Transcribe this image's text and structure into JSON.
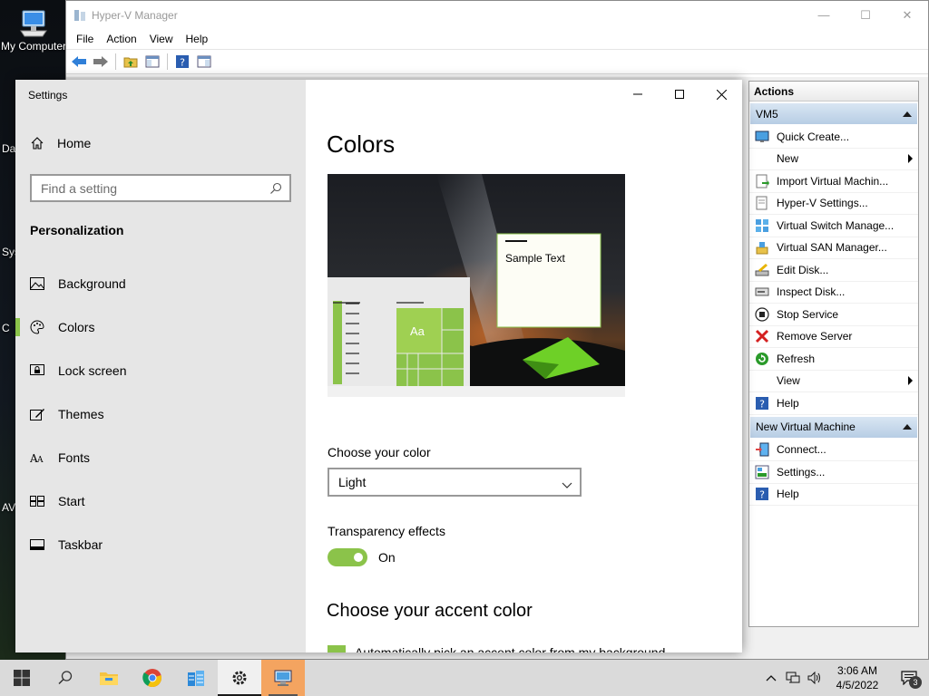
{
  "desktop": {
    "icon_label": "My Computer",
    "partial_labels": [
      "Da",
      "Sys",
      "C",
      "AV"
    ]
  },
  "hyperv": {
    "title": "Hyper-V Manager",
    "menu": [
      "File",
      "Action",
      "View",
      "Help"
    ],
    "actions_title": "Actions",
    "group1": {
      "name": "VM5",
      "items": [
        {
          "label": "Quick Create...",
          "icon": "quick-create-icon"
        },
        {
          "label": "New",
          "icon": "none",
          "submenu": true
        },
        {
          "label": "Import Virtual Machin...",
          "icon": "import-vm-icon"
        },
        {
          "label": "Hyper-V Settings...",
          "icon": "hyperv-settings-icon"
        },
        {
          "label": "Virtual Switch Manage...",
          "icon": "virtual-switch-icon"
        },
        {
          "label": "Virtual SAN Manager...",
          "icon": "virtual-san-icon"
        },
        {
          "label": "Edit Disk...",
          "icon": "edit-disk-icon"
        },
        {
          "label": "Inspect Disk...",
          "icon": "inspect-disk-icon"
        },
        {
          "label": "Stop Service",
          "icon": "stop-service-icon"
        },
        {
          "label": "Remove Server",
          "icon": "remove-server-icon"
        },
        {
          "label": "Refresh",
          "icon": "refresh-icon"
        },
        {
          "label": "View",
          "icon": "none",
          "submenu": true
        },
        {
          "label": "Help",
          "icon": "help-icon"
        }
      ]
    },
    "group2": {
      "name": "New Virtual Machine",
      "items": [
        {
          "label": "Connect...",
          "icon": "connect-icon"
        },
        {
          "label": "Settings...",
          "icon": "vm-settings-icon"
        },
        {
          "label": "Help",
          "icon": "help-icon"
        }
      ]
    }
  },
  "settings": {
    "app_title": "Settings",
    "home": "Home",
    "search_placeholder": "Find a setting",
    "section": "Personalization",
    "nav": [
      {
        "label": "Background",
        "icon": "background-icon"
      },
      {
        "label": "Colors",
        "icon": "colors-icon",
        "active": true
      },
      {
        "label": "Lock screen",
        "icon": "lock-screen-icon"
      },
      {
        "label": "Themes",
        "icon": "themes-icon"
      },
      {
        "label": "Fonts",
        "icon": "fonts-icon"
      },
      {
        "label": "Start",
        "icon": "start-icon"
      },
      {
        "label": "Taskbar",
        "icon": "taskbar-icon"
      }
    ],
    "page_title": "Colors",
    "preview": {
      "sample_text": "Sample Text",
      "tile_text": "Aa"
    },
    "choose_color_label": "Choose your color",
    "choose_color_value": "Light",
    "transparency_label": "Transparency effects",
    "transparency_state": "On",
    "accent_heading": "Choose your accent color",
    "auto_accent_label": "Automatically pick an accent color from my background",
    "accent_color": "#8bc34a"
  },
  "taskbar": {
    "time": "3:06 AM",
    "date": "4/5/2022",
    "notification_count": "3"
  }
}
